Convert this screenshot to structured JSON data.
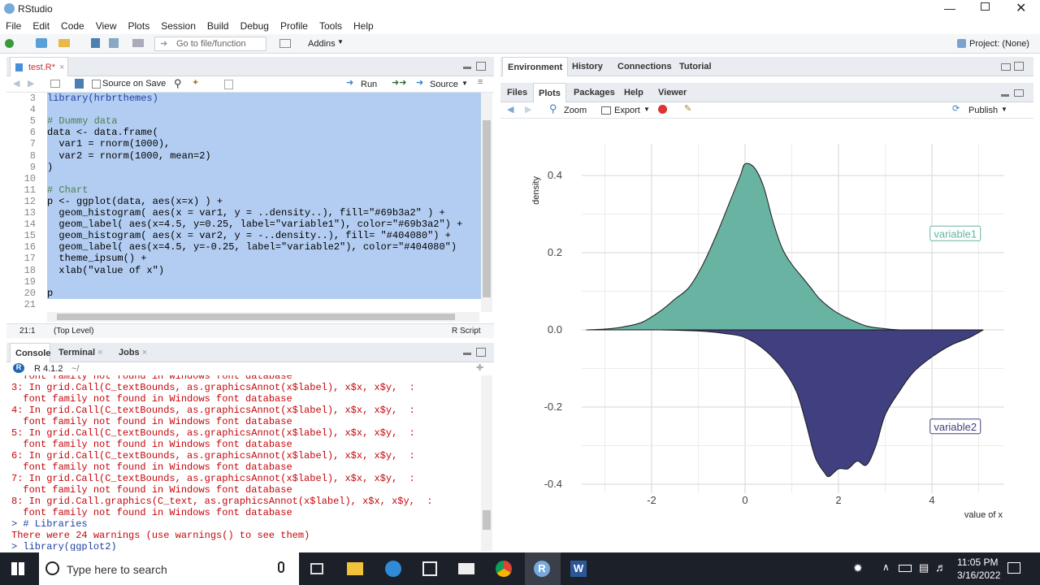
{
  "window": {
    "title": "RStudio",
    "controls": [
      "minimize-icon",
      "restore-icon",
      "close-icon"
    ]
  },
  "menu": [
    "File",
    "Edit",
    "Code",
    "View",
    "Plots",
    "Session",
    "Build",
    "Debug",
    "Profile",
    "Tools",
    "Help"
  ],
  "toolbar": {
    "goto_placeholder": "Go to file/function",
    "addins": "Addins",
    "project": "Project: (None)"
  },
  "editor": {
    "tab": "test.R*",
    "source_on_save": "Source on Save",
    "run": "Run",
    "source": "Source",
    "lines": [
      {
        "n": "3",
        "code": "library(hrbrthemes)"
      },
      {
        "n": "4",
        "code": ""
      },
      {
        "n": "5",
        "code": "# Dummy data"
      },
      {
        "n": "6",
        "code": "data <- data.frame("
      },
      {
        "n": "7",
        "code": "  var1 = rnorm(1000),"
      },
      {
        "n": "8",
        "code": "  var2 = rnorm(1000, mean=2)"
      },
      {
        "n": "9",
        "code": ")"
      },
      {
        "n": "10",
        "code": ""
      },
      {
        "n": "11",
        "code": "# Chart"
      },
      {
        "n": "12",
        "code": "p <- ggplot(data, aes(x=x) ) +"
      },
      {
        "n": "13",
        "code": "  geom_histogram( aes(x = var1, y = ..density..), fill=\"#69b3a2\" ) +"
      },
      {
        "n": "14",
        "code": "  geom_label( aes(x=4.5, y=0.25, label=\"variable1\"), color=\"#69b3a2\") +"
      },
      {
        "n": "15",
        "code": "  geom_histogram( aes(x = var2, y = -..density..), fill= \"#404080\") +"
      },
      {
        "n": "16",
        "code": "  geom_label( aes(x=4.5, y=-0.25, label=\"variable2\"), color=\"#404080\")"
      },
      {
        "n": "17",
        "code": "  theme_ipsum() +"
      },
      {
        "n": "18",
        "code": "  xlab(\"value of x\")"
      },
      {
        "n": "19",
        "code": ""
      },
      {
        "n": "20",
        "code": "p"
      },
      {
        "n": "21",
        "code": ""
      }
    ],
    "status_pos": "21:1",
    "status_scope": "(Top Level)",
    "status_type": "R Script"
  },
  "console": {
    "tabs": [
      "Console",
      "Terminal",
      "Jobs"
    ],
    "version": "R 4.1.2",
    "path": "~/",
    "lines": [
      "  font family not found in Windows font database",
      "3: In grid.Call(C_textBounds, as.graphicsAnnot(x$label), x$x, x$y,  :",
      "  font family not found in Windows font database",
      "4: In grid.Call(C_textBounds, as.graphicsAnnot(x$label), x$x, x$y,  :",
      "  font family not found in Windows font database",
      "5: In grid.Call(C_textBounds, as.graphicsAnnot(x$label), x$x, x$y,  :",
      "  font family not found in Windows font database",
      "6: In grid.Call(C_textBounds, as.graphicsAnnot(x$label), x$x, x$y,  :",
      "  font family not found in Windows font database",
      "7: In grid.Call(C_textBounds, as.graphicsAnnot(x$label), x$x, x$y,  :",
      "  font family not found in Windows font database",
      "8: In grid.Call.graphics(C_text, as.graphicsAnnot(x$label), x$x, x$y,  :",
      "  font family not found in Windows font database",
      "> # Libraries",
      "There were 24 warnings (use warnings() to see them)",
      "> library(ggplot2)"
    ]
  },
  "env_tabs": [
    "Environment",
    "History",
    "Connections",
    "Tutorial"
  ],
  "files_tabs": [
    "Files",
    "Plots",
    "Packages",
    "Help",
    "Viewer"
  ],
  "plots_toolbar": {
    "zoom": "Zoom",
    "export": "Export",
    "publish": "Publish"
  },
  "chart_data": {
    "type": "area",
    "xlabel": "value of x",
    "ylabel": "density",
    "xlim": [
      -3.5,
      5.1
    ],
    "ylim": [
      -0.4,
      0.4
    ],
    "x_ticks": [
      -2,
      0,
      2,
      4
    ],
    "y_ticks": [
      -0.4,
      -0.2,
      0.0,
      0.2,
      0.4
    ],
    "x_tick_labels": [
      "-2",
      "0",
      "2",
      "4"
    ],
    "y_tick_labels": [
      "-0.4",
      "-0.2",
      "0.0",
      "0.2",
      "0.4"
    ],
    "grid": true,
    "series": [
      {
        "name": "variable1",
        "color": "#69b3a2",
        "x": [
          -3.4,
          -3.0,
          -2.6,
          -2.2,
          -1.8,
          -1.5,
          -1.2,
          -0.9,
          -0.6,
          -0.3,
          -0.1,
          0.0,
          0.2,
          0.4,
          0.6,
          0.8,
          1.0,
          1.2,
          1.4,
          1.6,
          1.9,
          2.2,
          2.6,
          3.0,
          3.3
        ],
        "y": [
          0.0,
          0.002,
          0.008,
          0.02,
          0.05,
          0.08,
          0.11,
          0.17,
          0.25,
          0.34,
          0.4,
          0.43,
          0.42,
          0.37,
          0.28,
          0.21,
          0.17,
          0.14,
          0.11,
          0.08,
          0.05,
          0.03,
          0.01,
          0.003,
          0.0
        ]
      },
      {
        "name": "variable2",
        "color": "#404080",
        "x": [
          -1.8,
          -1.0,
          -0.4,
          0.0,
          0.4,
          0.8,
          1.1,
          1.3,
          1.5,
          1.7,
          1.8,
          2.0,
          2.2,
          2.4,
          2.6,
          2.8,
          3.0,
          3.3,
          3.6,
          4.0,
          4.4,
          4.8,
          5.1
        ],
        "y": [
          0.0,
          -0.003,
          -0.01,
          -0.02,
          -0.05,
          -0.1,
          -0.16,
          -0.24,
          -0.33,
          -0.37,
          -0.38,
          -0.36,
          -0.36,
          -0.34,
          -0.35,
          -0.3,
          -0.22,
          -0.16,
          -0.11,
          -0.07,
          -0.04,
          -0.02,
          0.0
        ]
      }
    ],
    "annotations": [
      {
        "label": "variable1",
        "x": 4.5,
        "y": 0.25,
        "color": "#69b3a2"
      },
      {
        "label": "variable2",
        "x": 4.5,
        "y": -0.25,
        "color": "#404080"
      }
    ]
  },
  "taskbar": {
    "search_placeholder": "Type here to search",
    "time": "11:05 PM",
    "date": "3/16/2022"
  }
}
